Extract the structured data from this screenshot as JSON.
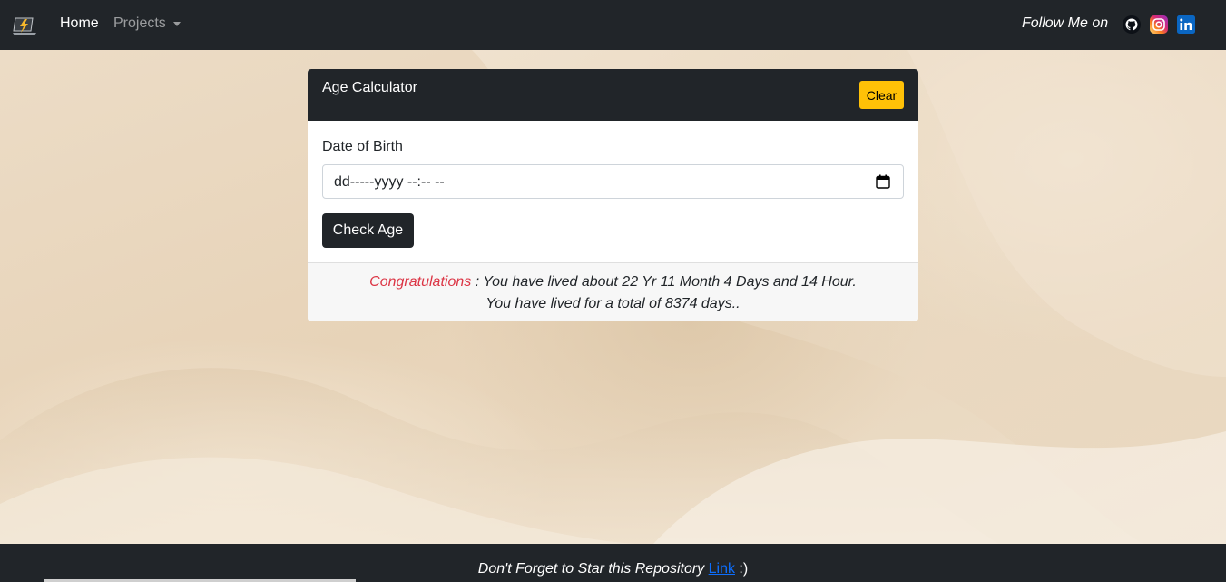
{
  "navbar": {
    "brand_icon": "lightning-laptop-logo",
    "home_label": "Home",
    "projects_label": "Projects",
    "follow_label": "Follow Me on",
    "social": [
      "github-icon",
      "instagram-icon",
      "linkedin-icon"
    ]
  },
  "card": {
    "title": "Age Calculator",
    "clear_label": "Clear",
    "dob_label": "Date of Birth",
    "date_value": "dd-----yyyy --:-- --",
    "check_label": "Check Age",
    "result": {
      "congrats": "Congratulations",
      "line1_rest": " : You have lived about 22 Yr 11 Month 4 Days and 14 Hour.",
      "line2": "You have lived for a total of 8374 days.."
    }
  },
  "footer": {
    "text": "Don't Forget to Star this Repository ",
    "link_label": "Link",
    "suffix": " :)"
  },
  "colors": {
    "dark": "#212529",
    "accent_yellow": "#ffc107",
    "congrats_red": "#dc3545",
    "link_blue": "#0d6efd"
  }
}
